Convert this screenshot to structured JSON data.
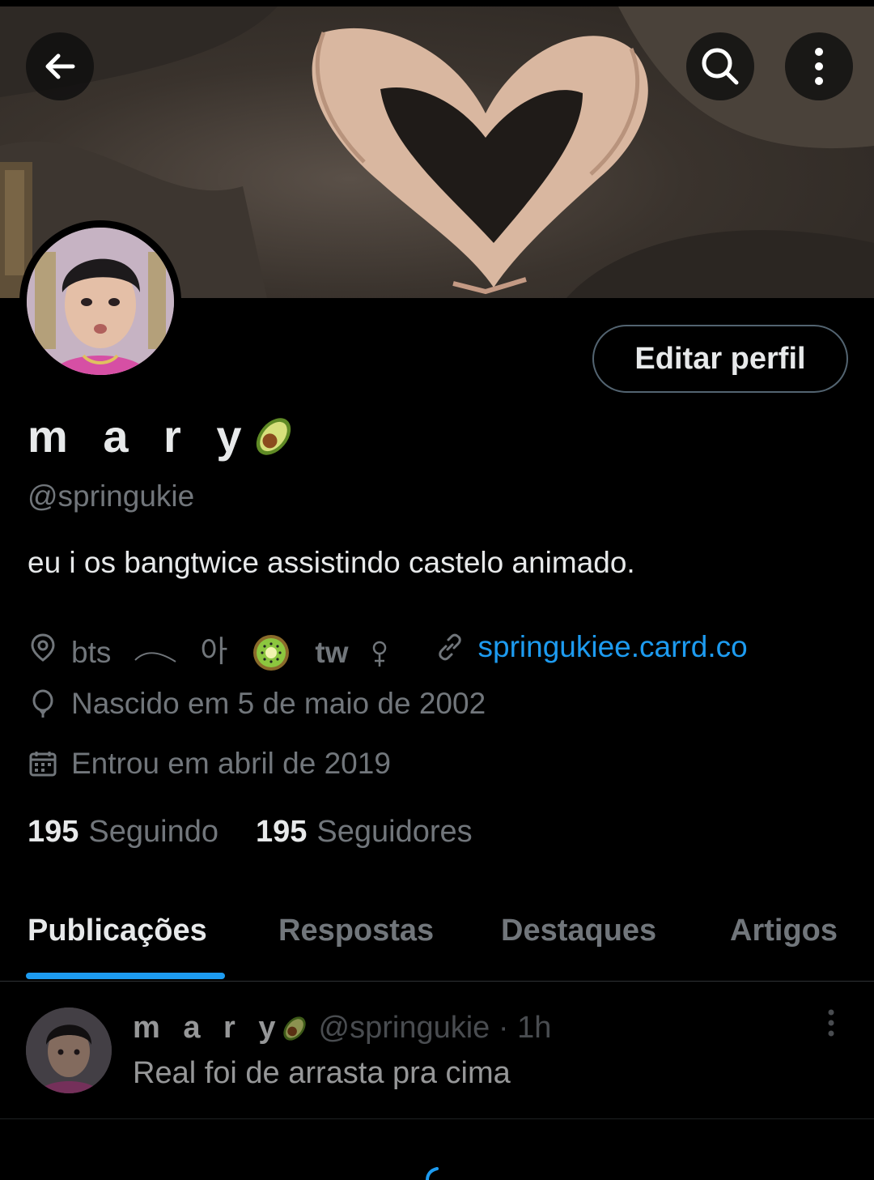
{
  "header": {
    "back_icon": "arrow-left-icon",
    "search_icon": "search-icon",
    "more_icon": "more-vertical-icon"
  },
  "profile": {
    "display_name": "m a r y",
    "name_emoji": "avocado",
    "handle": "@springukie",
    "bio": "eu i os bangtwice assistindo castelo animado.",
    "edit_button": "Editar perfil",
    "location": {
      "part1": "bts",
      "part2": "아",
      "part3": "tw",
      "emoji": "kiwi"
    },
    "link": "springukiee.carrd.co",
    "birthday": "Nascido em 5 de maio de 2002",
    "joined": "Entrou em abril de 2019"
  },
  "stats": {
    "following_count": "195",
    "following_label": "Seguindo",
    "followers_count": "195",
    "followers_label": "Seguidores"
  },
  "tabs": [
    {
      "label": "Publicações",
      "active": true
    },
    {
      "label": "Respostas",
      "active": false
    },
    {
      "label": "Destaques",
      "active": false
    },
    {
      "label": "Artigos",
      "active": false
    }
  ],
  "post": {
    "name": "m a r y",
    "handle": "@springukie · 1h",
    "text": "Real foi de arrasta pra cima"
  },
  "colors": {
    "accent": "#1d9bf0",
    "text_primary": "#e7e9ea",
    "text_secondary": "#71767b",
    "border": "#2f3336",
    "background": "#000000"
  }
}
